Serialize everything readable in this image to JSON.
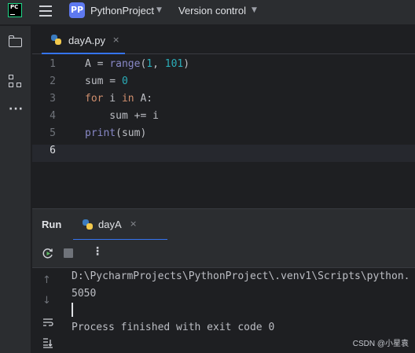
{
  "titlebar": {
    "logo_text": "PC",
    "project_badge": "PP",
    "project_name": "PythonProject",
    "vcs_label": "Version control"
  },
  "toolstrip": {
    "items": [
      "folder-icon",
      "structure-icon",
      "more-icon"
    ]
  },
  "editor": {
    "tab": {
      "filename": "dayA.py",
      "close": "×"
    },
    "line_numbers": [
      "1",
      "2",
      "3",
      "4",
      "5",
      "6"
    ],
    "active_line": 6,
    "lines": [
      "A = range(1, 101)",
      "sum = 0",
      "for i in A:",
      "    sum += i",
      "print(sum)",
      ""
    ]
  },
  "run_panel": {
    "title": "Run",
    "tab_name": "dayA",
    "tab_close": "×",
    "toolbar": {
      "rerun": "rerun-icon",
      "stop": "stop-icon",
      "menu": "⋮"
    },
    "console": {
      "command": "D:\\PycharmProjects\\PythonProject\\.venv1\\Scripts\\python.",
      "output": "5050",
      "exit_message": "Process finished with exit code 0"
    }
  },
  "watermark": "CSDN @小星袁",
  "colors": {
    "accent": "#3574f0",
    "keyword": "#cf8e6d",
    "number": "#2aacb8",
    "builtin": "#8888c6"
  }
}
